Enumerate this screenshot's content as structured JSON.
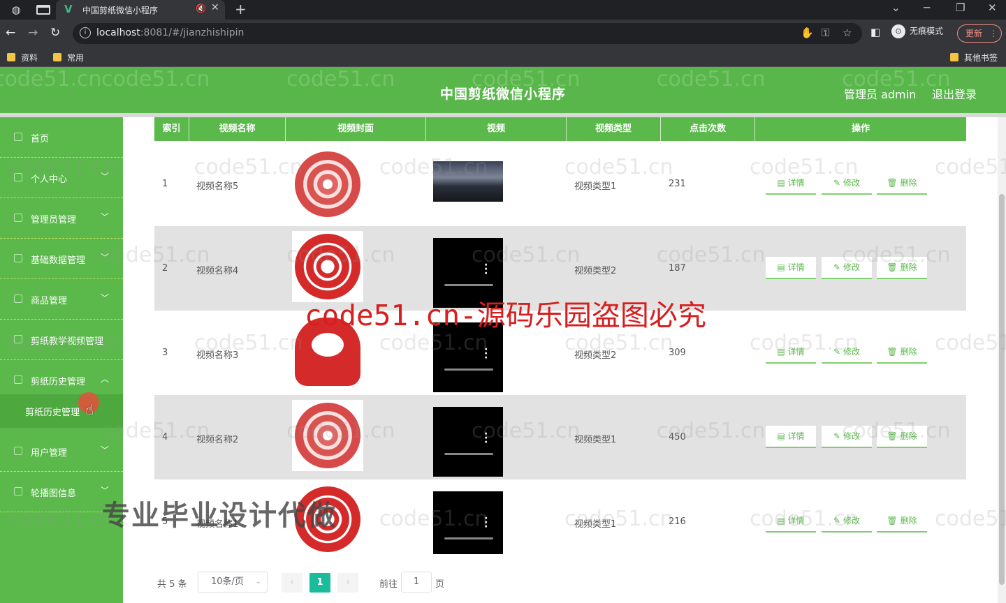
{
  "browser": {
    "tab_title": "中国剪纸微信小程序",
    "tab_favicon": "V",
    "url_host": "localhost",
    "url_rest": ":8081/#/jianzhishipin",
    "incognito_label": "无痕模式",
    "update_label": "更新",
    "bookmarks": [
      "资料",
      "常用"
    ],
    "other_bookmarks": "其他书签"
  },
  "app": {
    "title": "中国剪纸微信小程序",
    "user_label": "管理员 admin",
    "logout_label": "退出登录"
  },
  "sidebar": {
    "items": [
      {
        "label": "首页",
        "expandable": false
      },
      {
        "label": "个人中心",
        "expandable": true
      },
      {
        "label": "管理员管理",
        "expandable": true
      },
      {
        "label": "基础数据管理",
        "expandable": true
      },
      {
        "label": "商品管理",
        "expandable": true
      },
      {
        "label": "剪纸教学视频管理",
        "expandable": false
      },
      {
        "label": "剪纸历史管理",
        "expandable": true,
        "expanded": true
      },
      {
        "label": "用户管理",
        "expandable": true
      },
      {
        "label": "轮播图信息",
        "expandable": true
      }
    ],
    "sub_item": "剪纸历史管理"
  },
  "table": {
    "columns": [
      "索引",
      "视频名称",
      "视频封面",
      "视频",
      "视频类型",
      "点击次数",
      "操作"
    ],
    "rows": [
      {
        "index": "1",
        "name": "视频名称5",
        "type": "视频类型1",
        "clicks": "231"
      },
      {
        "index": "2",
        "name": "视频名称4",
        "type": "视频类型2",
        "clicks": "187"
      },
      {
        "index": "3",
        "name": "视频名称3",
        "type": "视频类型2",
        "clicks": "309"
      },
      {
        "index": "4",
        "name": "视频名称2",
        "type": "视频类型1",
        "clicks": "450"
      },
      {
        "index": "5",
        "name": "视频名称1",
        "type": "视频类型1",
        "clicks": "216"
      }
    ],
    "actions": {
      "detail": "详情",
      "edit": "修改",
      "delete": "删除"
    }
  },
  "pagination": {
    "total": "共 5 条",
    "page_size": "10条/页",
    "current_page": "1",
    "goto_label": "前往",
    "goto_value": "1",
    "page_suffix": "页"
  },
  "watermarks": {
    "repeat": "code51.cn",
    "banner": "code51.cn-源码乐园盗图必究",
    "ad": "专业毕业设计代做"
  },
  "colors": {
    "primary_green": "#5ab94a",
    "pager_active": "#1abc9c",
    "banner_red": "#d81e1e"
  }
}
